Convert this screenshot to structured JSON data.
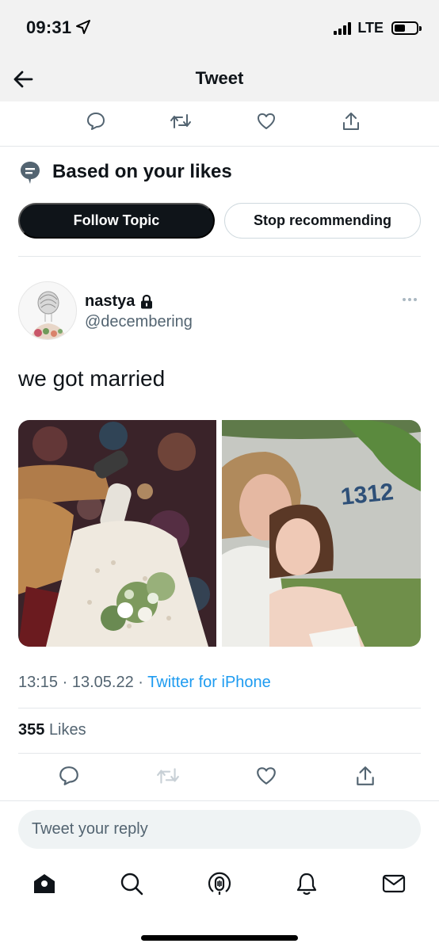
{
  "status_bar": {
    "time": "09:31",
    "network": "LTE",
    "icons": [
      "location-arrow-icon",
      "signal-icon",
      "battery-icon"
    ]
  },
  "header": {
    "title": "Tweet",
    "back_icon": "back-arrow-icon"
  },
  "top_actions": [
    "reply-icon",
    "retweet-icon",
    "like-icon",
    "share-icon"
  ],
  "topic": {
    "title": "Based on your likes",
    "icon": "topic-bubble-icon",
    "follow_label": "Follow Topic",
    "stop_label": "Stop recommending"
  },
  "tweet": {
    "author_name": "nastya",
    "author_handle": "@decembering",
    "locked_icon": "lock-icon",
    "text": "we got married",
    "time": "13:15",
    "date": "13.05.22",
    "separator": "·",
    "source": "Twitter for iPhone",
    "likes_count": "355",
    "likes_label": "Likes"
  },
  "bottom_actions": [
    "reply-icon",
    "retweet-icon",
    "like-icon",
    "share-icon"
  ],
  "reply": {
    "placeholder": "Tweet your reply"
  },
  "tab_bar": [
    "home-icon",
    "search-icon",
    "spaces-icon",
    "notifications-icon",
    "messages-icon"
  ],
  "colors": {
    "accent": "#1d9bf0",
    "text": "#0f1419",
    "secondary": "#536471",
    "divider": "#e4e7ea"
  }
}
